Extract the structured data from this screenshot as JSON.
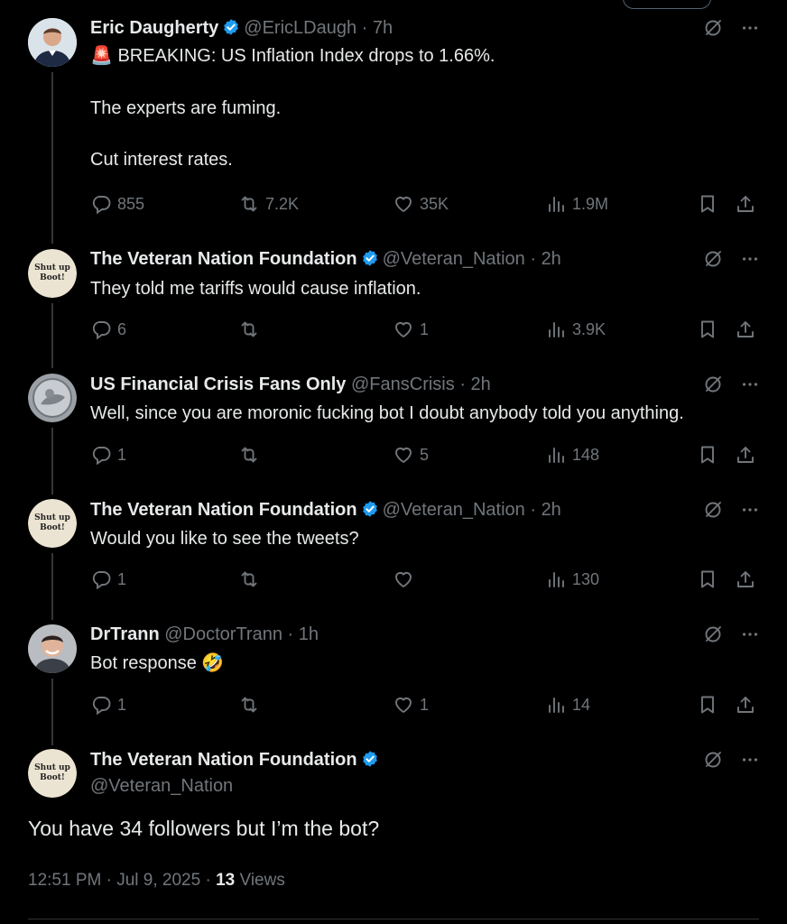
{
  "tweets": [
    {
      "name": "Eric Daugherty",
      "handle": "@EricLDaugh",
      "time": "7h",
      "lines": [
        "🚨 BREAKING: US Inflation Index drops to 1.66%.",
        "The experts are fuming.",
        "Cut interest rates."
      ],
      "replies": "855",
      "retweets": "7.2K",
      "likes": "35K",
      "views": "1.9M"
    },
    {
      "name": "The Veteran Nation Foundation",
      "handle": "@Veteran_Nation",
      "time": "2h",
      "lines": [
        "They told me tariffs would cause inflation."
      ],
      "replies": "6",
      "retweets": "",
      "likes": "1",
      "views": "3.9K"
    },
    {
      "name": "US Financial Crisis Fans Only",
      "handle": "@FansCrisis",
      "time": "2h",
      "lines": [
        "Well, since you are moronic fucking bot I doubt anybody told you anything."
      ],
      "replies": "1",
      "retweets": "",
      "likes": "5",
      "views": "148"
    },
    {
      "name": "The Veteran Nation Foundation",
      "handle": "@Veteran_Nation",
      "time": "2h",
      "lines": [
        "Would you like to see the tweets?"
      ],
      "replies": "1",
      "retweets": "",
      "likes": "",
      "views": "130"
    },
    {
      "name": "DrTrann",
      "handle": "@DoctorTrann",
      "time": "1h",
      "lines": [
        "Bot response 🤣"
      ],
      "replies": "1",
      "retweets": "",
      "likes": "1",
      "views": "14"
    }
  ],
  "main_tweet": {
    "name": "The Veteran Nation Foundation",
    "handle": "@Veteran_Nation",
    "text": "You have 34 followers but I’m the bot?",
    "time": "12:51 PM",
    "date": "Jul 9, 2025",
    "views_count": "13",
    "views_label": "Views"
  },
  "avatar_badge": {
    "line1": "Shut up",
    "line2": "Boot!"
  },
  "separator": "·",
  "colors": {
    "background": "#000000",
    "text": "#e7e9ea",
    "muted": "#71767b",
    "verified": "#1d9bf0"
  }
}
